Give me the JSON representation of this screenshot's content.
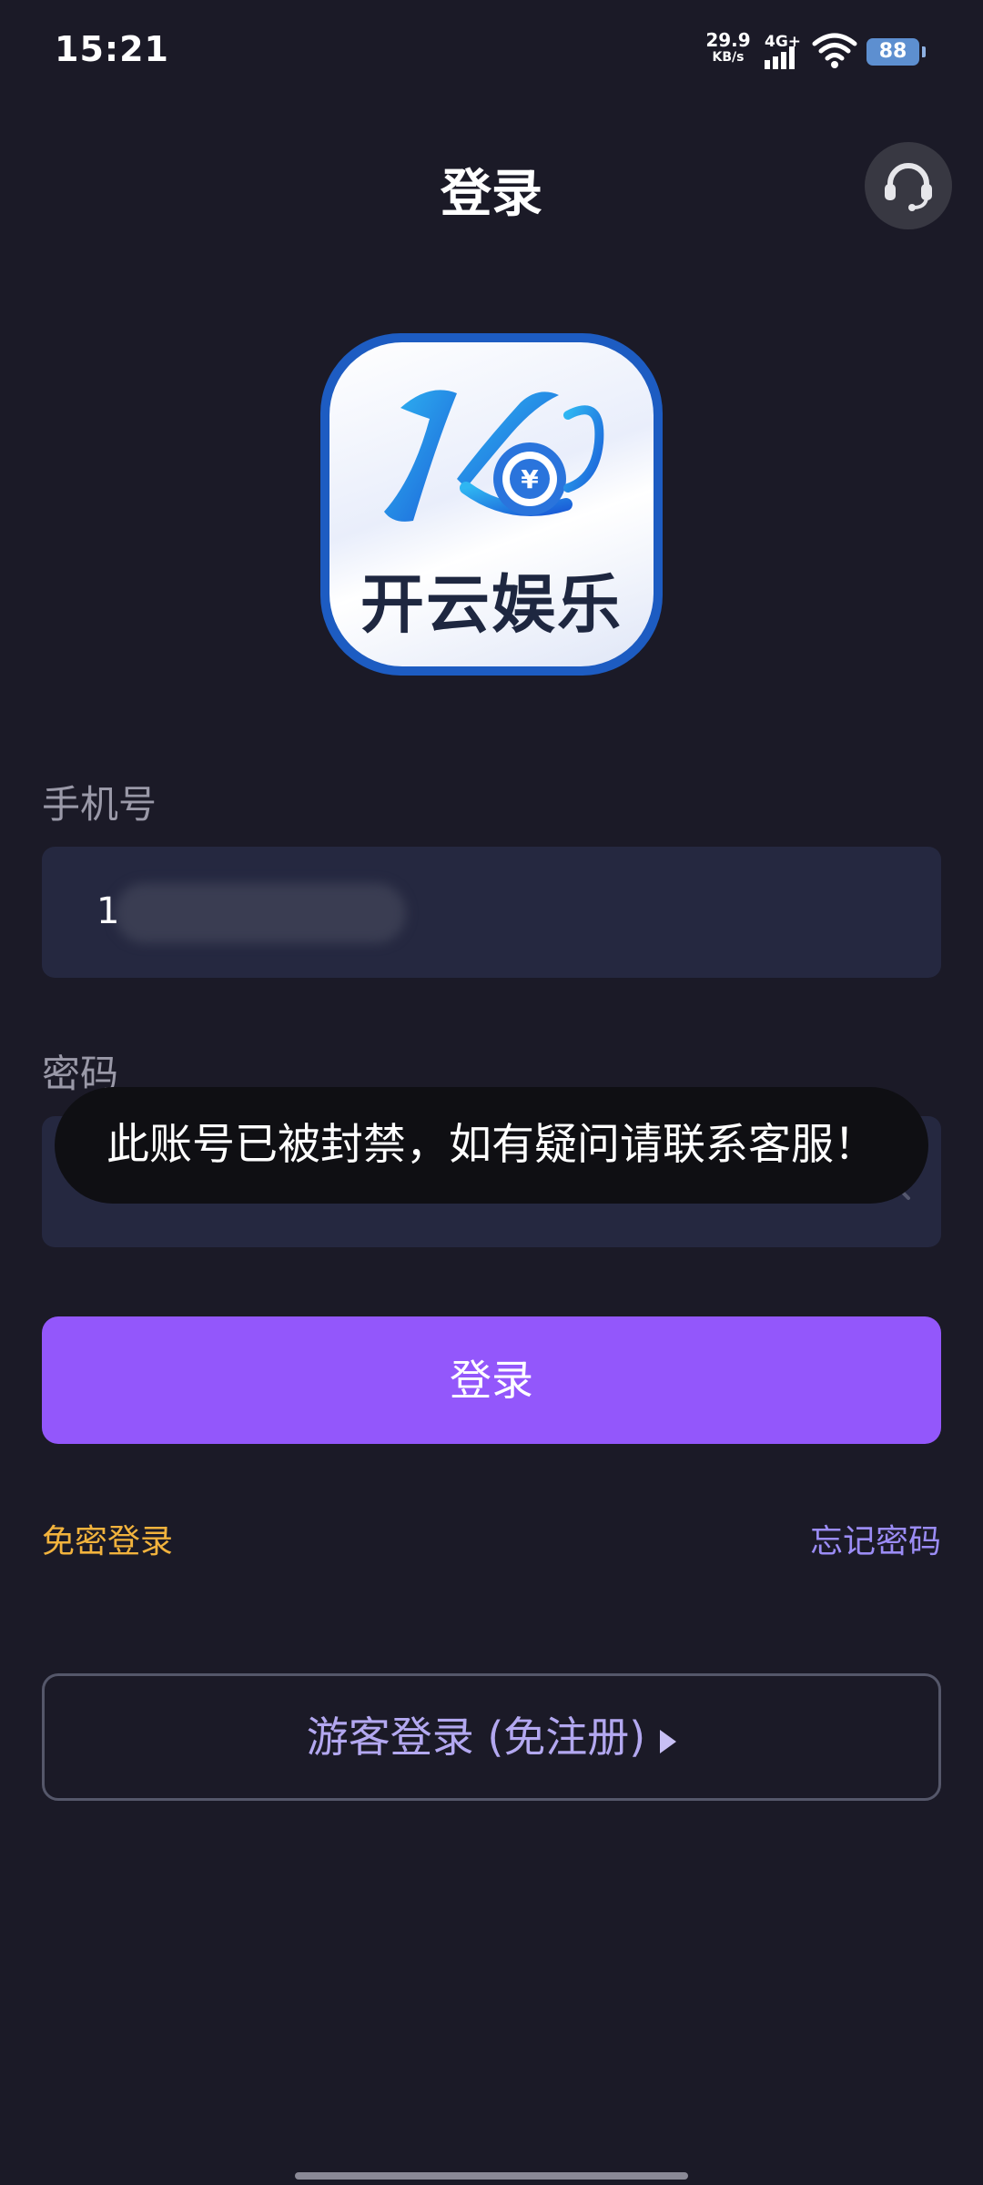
{
  "status_bar": {
    "time": "15:21",
    "net_speed_value": "29.9",
    "net_speed_unit": "KB/s",
    "network_type": "4G+",
    "battery_level": "88"
  },
  "header": {
    "title": "登录",
    "support_icon": "headset-icon"
  },
  "logo": {
    "icon": "app-logo",
    "text": "开云娱乐"
  },
  "form": {
    "phone_label": "手机号",
    "phone_value": "1",
    "password_label": "密码",
    "password_mask": "••••••••",
    "eye_icon": "eye-off-icon"
  },
  "actions": {
    "login_button": "登录",
    "passwordless_login": "免密登录",
    "forgot_password": "忘记密码",
    "guest_login": "游客登录 (免注册)"
  },
  "toast": {
    "message": "此账号已被封禁，如有疑问请联系客服！"
  },
  "colors": {
    "background": "#1b1a27",
    "input_background": "#252840",
    "primary": "#9357fb",
    "passwordless_link": "#f2b33d",
    "forgot_link": "#9b8cf5",
    "guest_text": "#b3a8f0"
  }
}
